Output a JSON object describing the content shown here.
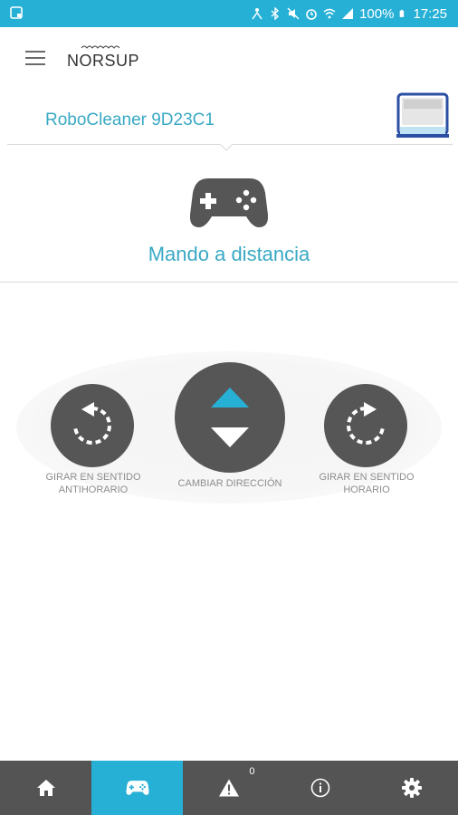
{
  "status_bar": {
    "battery": "100%",
    "time": "17:25"
  },
  "header": {
    "logo_text": "NORSUP"
  },
  "device": {
    "name": "RoboCleaner 9D23C1"
  },
  "mode": {
    "title": "Mando a distancia",
    "icon": "gamepad-icon"
  },
  "controls": {
    "left_label": "GIRAR EN SENTIDO ANTIHORARIO",
    "center_label": "CAMBIAR DIRECCIÓN",
    "right_label": "GIRAR EN SENTIDO HORARIO"
  },
  "bottom_nav": {
    "items": [
      {
        "icon": "home-icon"
      },
      {
        "icon": "gamepad-icon",
        "active": true
      },
      {
        "icon": "warning-icon",
        "badge": "0"
      },
      {
        "icon": "info-icon"
      },
      {
        "icon": "gear-icon"
      }
    ]
  },
  "colors": {
    "accent": "#27b0d6",
    "text_accent": "#39a9c4",
    "button_dark": "#565656",
    "nav_bg": "#545454"
  }
}
